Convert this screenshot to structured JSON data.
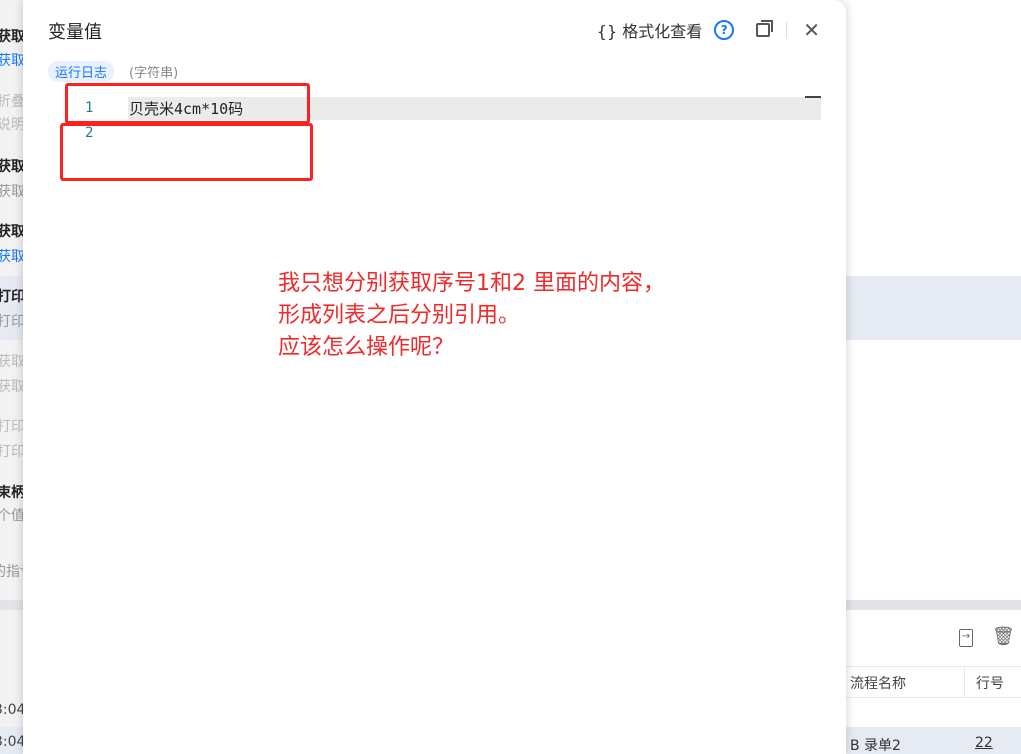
{
  "background_left": {
    "items": [
      "获取",
      "获取",
      "折叠",
      "说明",
      "获取",
      "获取",
      "获取",
      "获取",
      "打印",
      "打印",
      "获取",
      "获取",
      "打印",
      "打印",
      "束柄",
      "个值",
      "的指令",
      "3:04",
      "3:04"
    ]
  },
  "background_right": {
    "table": {
      "headers": [
        "流程名称",
        "行号"
      ],
      "rows": [
        [
          "",
          ""
        ],
        [
          "B 录单2",
          "22"
        ]
      ]
    }
  },
  "modal": {
    "title": "变量值",
    "format_label": "{} 格式化查看",
    "help": "?",
    "tag": "运行日志",
    "type": "(字符串)",
    "lines": [
      {
        "num": "1",
        "text": "贝壳米4cm*10码"
      },
      {
        "num": "2",
        "text": ""
      }
    ]
  },
  "annotation": {
    "lines": [
      "我只想分别获取序号1和2 里面的内容，",
      "形成列表之后分别引用。",
      "应该怎么操作呢？"
    ],
    "color": "#f02a2a"
  }
}
